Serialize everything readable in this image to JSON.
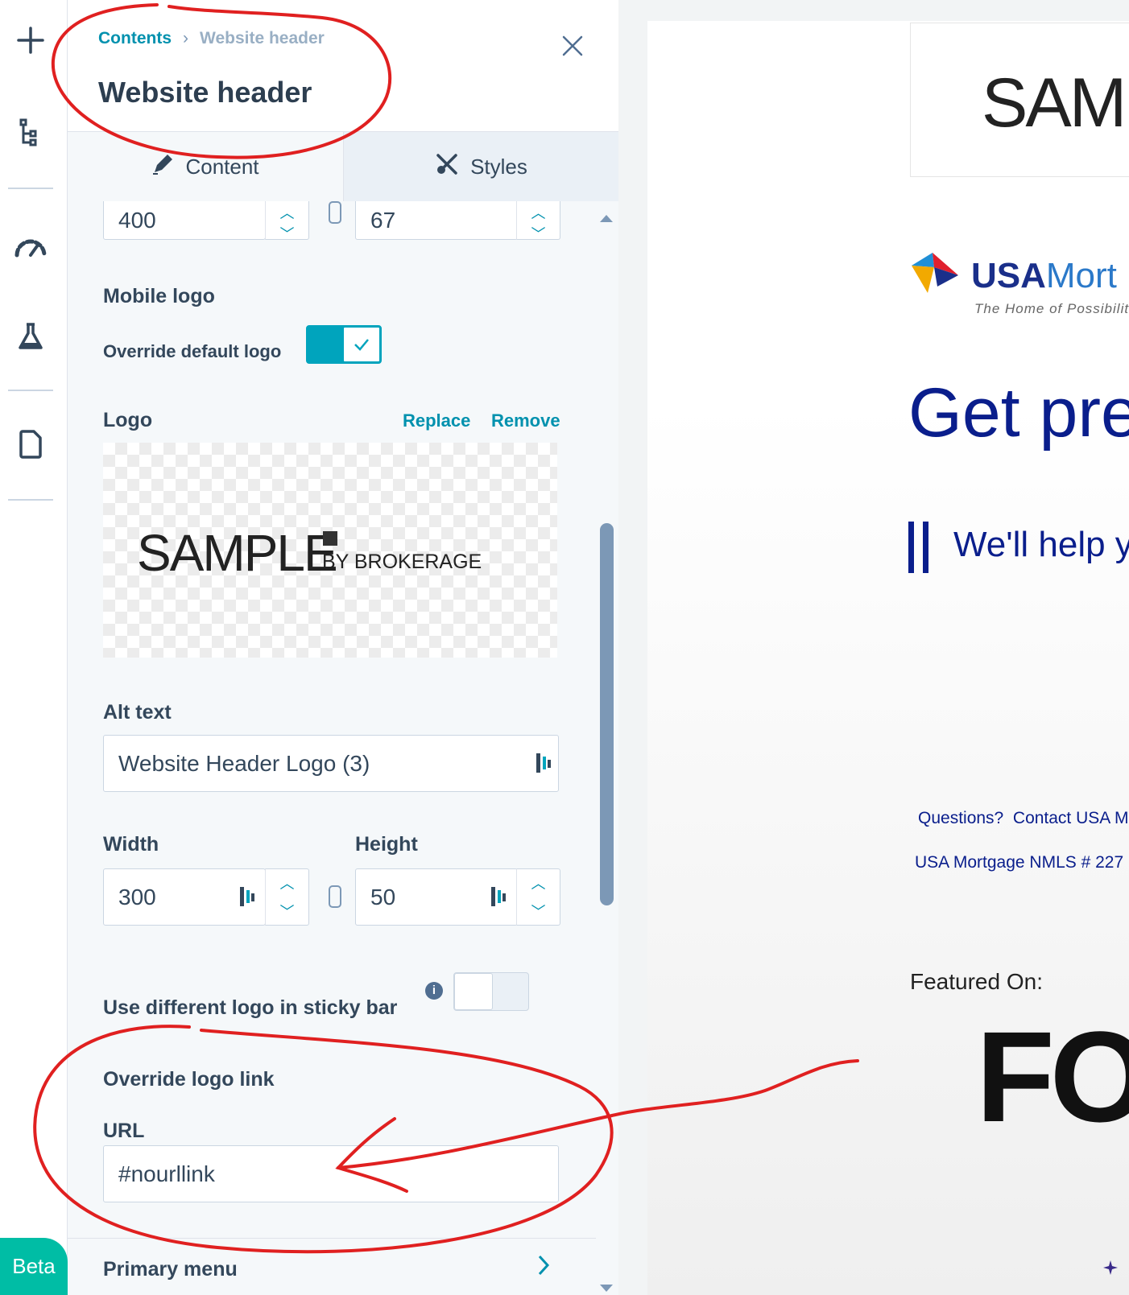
{
  "panel": {
    "breadcrumb": {
      "parent": "Contents",
      "separator": "›",
      "current": "Website header"
    },
    "title": "Website header",
    "tabs": [
      {
        "label": "Content"
      },
      {
        "label": "Styles"
      }
    ],
    "top_size": {
      "width": "400",
      "height": "67"
    },
    "mobile_logo": {
      "heading": "Mobile logo",
      "override_label": "Override default logo",
      "override_on": true
    },
    "logo": {
      "label": "Logo",
      "replace": "Replace",
      "remove": "Remove",
      "preview_main": "SAMPLE",
      "preview_sub": "BY BROKERAGE"
    },
    "alt_text": {
      "label": "Alt text",
      "value": "Website Header Logo (3)"
    },
    "size": {
      "width_label": "Width",
      "height_label": "Height",
      "width": "300",
      "height": "50"
    },
    "sticky": {
      "label": "Use different logo in sticky bar",
      "on": false
    },
    "override_link": {
      "heading": "Override logo link",
      "url_label": "URL",
      "url_value": "#nourllink"
    },
    "primary_menu": "Primary menu"
  },
  "rail": {
    "beta": "Beta"
  },
  "preview": {
    "logo_text": "SAMP",
    "brand": {
      "usa": "USA",
      "mort": "Mort",
      "tagline": "The Home of Possibilit"
    },
    "headline": "Get pre",
    "subhead": "We'll help y",
    "contact": "Questions?  Contact USA M",
    "nmls": "USA Mortgage NMLS # 227",
    "featured": "Featured On:",
    "featured_logo": "FO"
  },
  "colors": {
    "accent": "#0091ae",
    "toggle_on": "#00a4bd",
    "annotation": "#e02020",
    "preview_blue": "#0a1e8c"
  }
}
